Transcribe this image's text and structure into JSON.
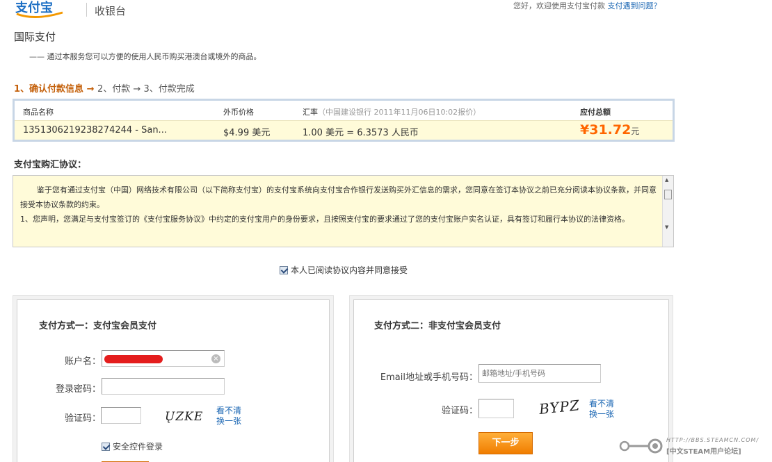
{
  "header": {
    "brand": "支付宝",
    "cashier_label": "收银台",
    "welcome_text": "您好，欢迎使用支付宝付款",
    "help_link": "支付遇到问题？"
  },
  "page": {
    "title": "国际支付",
    "subtitle": "—— 通过本服务您可以方便的使用人民币购买港澳台或境外的商品。"
  },
  "steps": {
    "step1": "1、确认付款信息",
    "arrow1": " → ",
    "step2": "2、付款",
    "arrow2": " → ",
    "step3": "3、付款完成"
  },
  "order": {
    "headers": {
      "name": "商品名称",
      "price": "外币价格",
      "rate": "汇率",
      "rate_note": "（中国建设银行 2011年11月06日10:02报价）",
      "total": "应付总额"
    },
    "item": {
      "name": "1351306219238274244 - San...",
      "price": "$4.99 美元",
      "rate": "1.00 美元 = 6.3573 人民币",
      "total": "¥31.72",
      "total_unit": "元"
    }
  },
  "agreement": {
    "title": "支付宝购汇协议：",
    "para1": "鉴于您有通过支付宝（中国）网络技术有限公司（以下简称支付宝）的支付宝系统向支付宝合作银行发送购买外汇信息的需求，您同意在签订本协议之前已充分阅读本协议条款，并同意接受本协议条款的约束。",
    "para2": "1、您声明，您满足与支付宝签订的《支付宝服务协议》中约定的支付宝用户的身份要求，且按照支付宝的要求通过了您的支付宝账户实名认证，具有签订和履行本协议的法律资格。",
    "accept_label": "本人已阅读协议内容并同意接受"
  },
  "member_pay": {
    "title": "支付方式一：支付宝会员支付",
    "account_label": "账户名：",
    "password_label": "登录密码：",
    "captcha_label": "验证码：",
    "captcha_text": "ŲZKE",
    "unclear_link": "看不清",
    "refresh_link": "换一张",
    "secure_login_label": "安全控件登录"
  },
  "guest_pay": {
    "title": "支付方式二：非支付宝会员支付",
    "email_label": "Email地址或手机号码：",
    "email_placeholder": "邮箱地址/手机号码",
    "captcha_label": "验证码：",
    "captcha_text": "BYPZ",
    "unclear_link": "看不清",
    "refresh_link": "换一张",
    "next_button": "下一步"
  },
  "watermark": {
    "url": "HTTP://BBS.STEAMCN.COM/",
    "name": "[中文STEAM用户论坛]"
  },
  "colors": {
    "accent_orange": "#f60",
    "link_blue": "#1a66b3",
    "highlight_yellow": "#fffbd9",
    "brand_blue": "#1976d2"
  }
}
